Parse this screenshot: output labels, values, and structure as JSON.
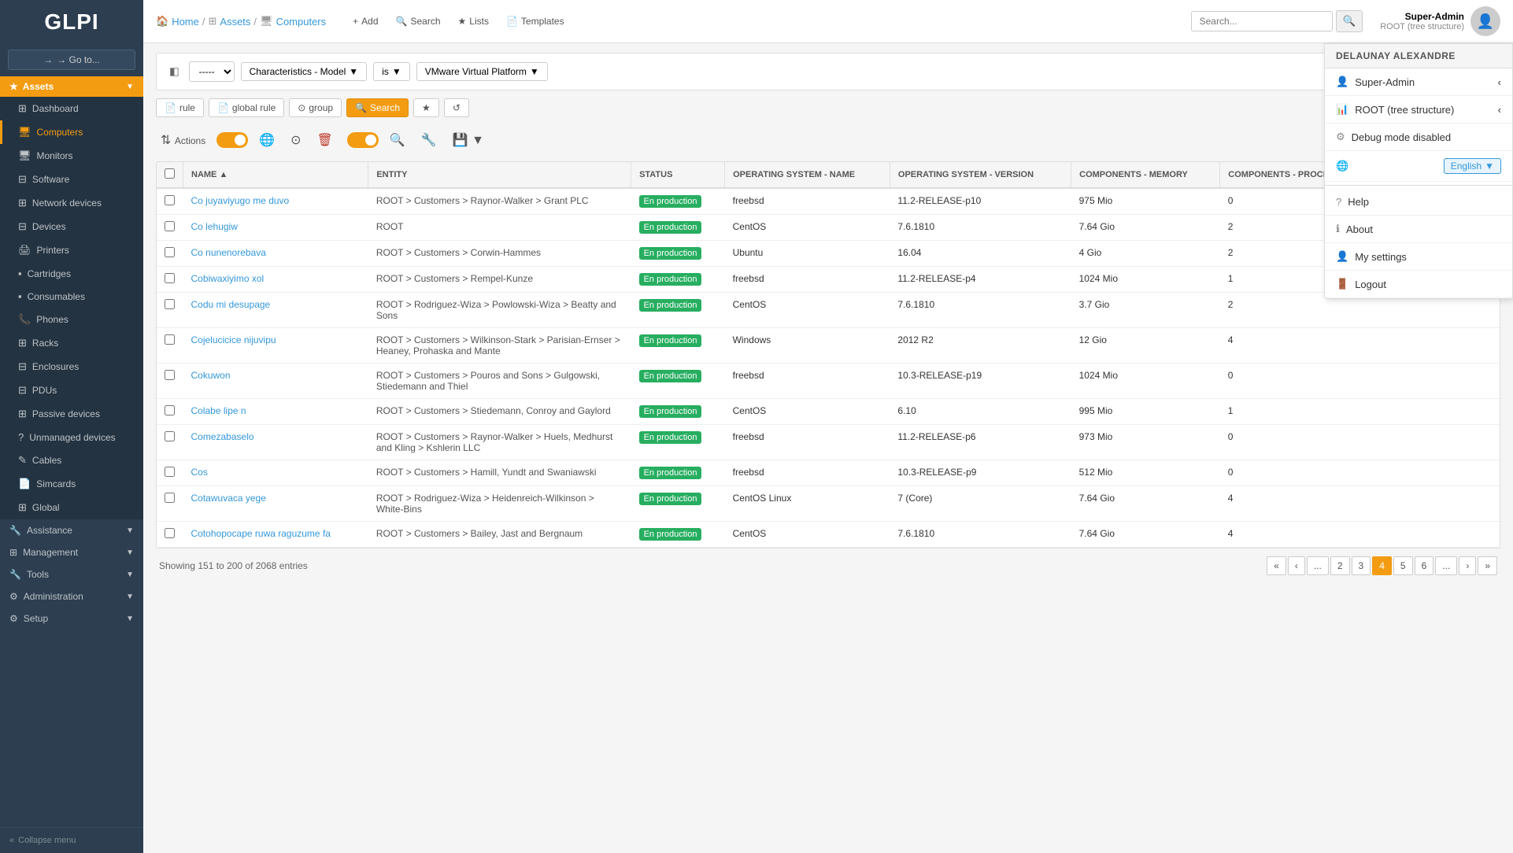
{
  "app": {
    "logo": "GLPI",
    "goto_label": "→ Go to...",
    "collapse_label": "« Collapse menu"
  },
  "sidebar": {
    "assets_section": "Assets",
    "items": [
      {
        "id": "dashboard",
        "label": "Dashboard",
        "icon": "⊞",
        "active": false
      },
      {
        "id": "computers",
        "label": "Computers",
        "icon": "🖥",
        "active": true
      },
      {
        "id": "monitors",
        "label": "Monitors",
        "icon": "🖥",
        "active": false
      },
      {
        "id": "software",
        "label": "Software",
        "icon": "⊟",
        "active": false
      },
      {
        "id": "network-devices",
        "label": "Network devices",
        "icon": "⊞",
        "active": false
      },
      {
        "id": "devices",
        "label": "Devices",
        "icon": "⊟",
        "active": false
      },
      {
        "id": "printers",
        "label": "Printers",
        "icon": "🖨",
        "active": false
      },
      {
        "id": "cartridges",
        "label": "Cartridges",
        "icon": "⬛",
        "active": false
      },
      {
        "id": "consumables",
        "label": "Consumables",
        "icon": "⬛",
        "active": false
      },
      {
        "id": "phones",
        "label": "Phones",
        "icon": "📞",
        "active": false
      },
      {
        "id": "racks",
        "label": "Racks",
        "icon": "⊞",
        "active": false
      },
      {
        "id": "enclosures",
        "label": "Enclosures",
        "icon": "⊟",
        "active": false
      },
      {
        "id": "pdus",
        "label": "PDUs",
        "icon": "⊟",
        "active": false
      },
      {
        "id": "passive-devices",
        "label": "Passive devices",
        "icon": "⊞",
        "active": false
      },
      {
        "id": "unmanaged-devices",
        "label": "Unmanaged devices",
        "icon": "?",
        "active": false
      },
      {
        "id": "cables",
        "label": "Cables",
        "icon": "✎",
        "active": false
      },
      {
        "id": "simcards",
        "label": "Simcards",
        "icon": "📄",
        "active": false
      },
      {
        "id": "global",
        "label": "Global",
        "icon": "⊞",
        "active": false
      }
    ],
    "bottom_sections": [
      {
        "id": "assistance",
        "label": "Assistance",
        "icon": "🔧"
      },
      {
        "id": "management",
        "label": "Management",
        "icon": "⊞"
      },
      {
        "id": "tools",
        "label": "Tools",
        "icon": "🔧"
      },
      {
        "id": "administration",
        "label": "Administration",
        "icon": "⚙"
      },
      {
        "id": "setup",
        "label": "Setup",
        "icon": "⚙"
      }
    ]
  },
  "topbar": {
    "breadcrumb": [
      "Home",
      "Assets",
      "Computers"
    ],
    "actions": [
      {
        "label": "+ Add",
        "icon": "+"
      },
      {
        "label": "🔍 Search",
        "icon": "🔍"
      },
      {
        "label": "★ Lists",
        "icon": "★"
      },
      {
        "label": "📄 Templates",
        "icon": "📄"
      }
    ],
    "search_placeholder": "Search...",
    "user": {
      "name": "Super-Admin",
      "role": "ROOT (tree structure)",
      "avatar_text": "👤"
    }
  },
  "filter": {
    "operator_value": "-----",
    "field_value": "Characteristics - Model",
    "condition_value": "is",
    "filter_value": "VMware Virtual Platform",
    "buttons": {
      "rule": "rule",
      "global_rule": "global rule",
      "group": "group",
      "search": "Search"
    }
  },
  "table": {
    "columns": [
      {
        "id": "name",
        "label": "NAME ▲"
      },
      {
        "id": "entity",
        "label": "ENTITY"
      },
      {
        "id": "status",
        "label": "STATUS"
      },
      {
        "id": "os_name",
        "label": "OPERATING SYSTEM - NAME"
      },
      {
        "id": "os_version",
        "label": "OPERATING SYSTEM - VERSION"
      },
      {
        "id": "memory",
        "label": "COMPONENTS - MEMORY"
      },
      {
        "id": "cores",
        "label": "COMPONENTS - PROCESSOR - NUMBER OF CORES"
      }
    ],
    "rows": [
      {
        "name": "Co juyaviyugo me duvo",
        "entity": "ROOT > Customers > Raynor-Walker > Grant PLC",
        "status": "En production",
        "os_name": "freebsd",
        "os_version": "11.2-RELEASE-p10",
        "memory": "975 Mio",
        "cores": "0"
      },
      {
        "name": "Co lehugiw",
        "entity": "ROOT",
        "status": "En production",
        "os_name": "CentOS",
        "os_version": "7.6.1810",
        "memory": "7.64 Gio",
        "cores": "2"
      },
      {
        "name": "Co nunenorebava",
        "entity": "ROOT > Customers > Corwin-Hammes",
        "status": "En production",
        "os_name": "Ubuntu",
        "os_version": "16.04",
        "memory": "4 Gio",
        "cores": "2"
      },
      {
        "name": "Cobiwaxiyimo xol",
        "entity": "ROOT > Customers > Rempel-Kunze",
        "status": "En production",
        "os_name": "freebsd",
        "os_version": "11.2-RELEASE-p4",
        "memory": "1024 Mio",
        "cores": "1"
      },
      {
        "name": "Codu mi desupage",
        "entity": "ROOT > Rodriguez-Wiza > Powlowski-Wiza > Beatty and Sons",
        "status": "En production",
        "os_name": "CentOS",
        "os_version": "7.6.1810",
        "memory": "3.7 Gio",
        "cores": "2"
      },
      {
        "name": "Cojelucicice nijuvipu",
        "entity": "ROOT > Customers > Wilkinson-Stark > Parisian-Ernser > Heaney, Prohaska and Mante",
        "status": "En production",
        "os_name": "Windows",
        "os_version": "2012 R2",
        "memory": "12 Gio",
        "cores": "4"
      },
      {
        "name": "Cokuwon",
        "entity": "ROOT > Customers > Pouros and Sons > Gulgowski, Stiedemann and Thiel",
        "status": "En production",
        "os_name": "freebsd",
        "os_version": "10.3-RELEASE-p19",
        "memory": "1024 Mio",
        "cores": "0"
      },
      {
        "name": "Colabe lipe n",
        "entity": "ROOT > Customers > Stiedemann, Conroy and Gaylord",
        "status": "En production",
        "os_name": "CentOS",
        "os_version": "6.10",
        "memory": "995 Mio",
        "cores": "1"
      },
      {
        "name": "Comezabaselo",
        "entity": "ROOT > Customers > Raynor-Walker > Huels, Medhurst and Kling > Kshlerin LLC",
        "status": "En production",
        "os_name": "freebsd",
        "os_version": "11.2-RELEASE-p6",
        "memory": "973 Mio",
        "cores": "0"
      },
      {
        "name": "Cos",
        "entity": "ROOT > Customers > Hamill, Yundt and Swaniawski",
        "status": "En production",
        "os_name": "freebsd",
        "os_version": "10.3-RELEASE-p9",
        "memory": "512 Mio",
        "cores": "0"
      },
      {
        "name": "Cotawuvaca yege",
        "entity": "ROOT > Rodriguez-Wiza > Heidenreich-Wilkinson > White-Bins",
        "status": "En production",
        "os_name": "CentOS Linux",
        "os_version": "7 (Core)",
        "memory": "7.64 Gio",
        "cores": "4"
      },
      {
        "name": "Cotohopocape ruwa raguzume fa",
        "entity": "ROOT > Customers > Bailey, Jast and Bergnaum",
        "status": "En production",
        "os_name": "CentOS",
        "os_version": "7.6.1810",
        "memory": "7.64 Gio",
        "cores": "4"
      }
    ],
    "pagination": {
      "showing": "Showing 151 to 200 of 2068 entries",
      "pages": [
        "2",
        "3",
        "4",
        "5",
        "6"
      ],
      "current_page": "4",
      "ellipsis": "..."
    }
  },
  "user_dropdown": {
    "username": "DELAUNAY ALEXANDRE",
    "items": [
      {
        "id": "super-admin",
        "label": "Super-Admin",
        "icon": "👤",
        "has_arrow": true
      },
      {
        "id": "root-structure",
        "label": "ROOT (tree structure)",
        "icon": "📊",
        "has_arrow": true
      },
      {
        "id": "debug-mode",
        "label": "Debug mode disabled",
        "icon": "⚙",
        "has_arrow": false
      },
      {
        "id": "english",
        "label": "English",
        "icon": "🌐",
        "is_lang": true
      },
      {
        "id": "help",
        "label": "Help",
        "icon": "?"
      },
      {
        "id": "about",
        "label": "About",
        "icon": "ℹ"
      },
      {
        "id": "my-settings",
        "label": "My settings",
        "icon": "👤"
      },
      {
        "id": "logout",
        "label": "Logout",
        "icon": "🚪"
      }
    ]
  }
}
